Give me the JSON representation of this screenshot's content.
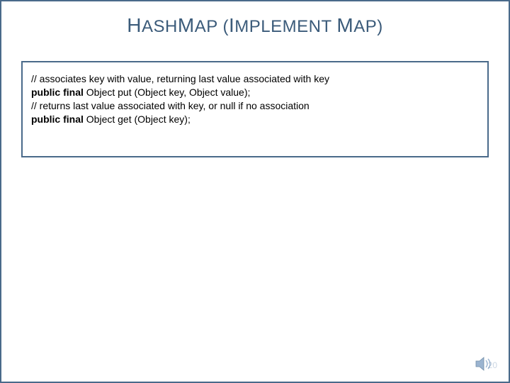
{
  "title": {
    "parts": [
      "H",
      "ASH",
      "M",
      "AP",
      " (",
      "I",
      "MPLEMENT ",
      "M",
      "AP",
      ")"
    ]
  },
  "code": {
    "line1": "// associates key with value, returning last value associated with key",
    "line2_prefix": "public final",
    "line2_rest": " Object put (Object key, Object value);",
    "line3": "// returns last value associated with key, or null if no association",
    "line4_prefix": "public final",
    "line4_rest": " Object get (Object key);"
  },
  "page_number": "20"
}
